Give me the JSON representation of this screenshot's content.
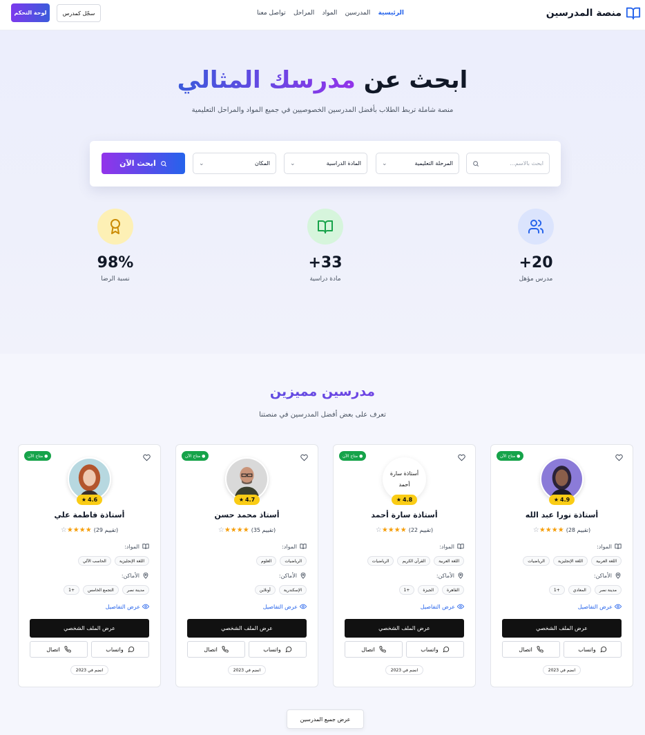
{
  "nav": {
    "brand": "منصة المدرسين",
    "links": [
      "الرئيسية",
      "المدرسين",
      "المواد",
      "المراحل",
      "تواصل معنا"
    ],
    "register_label": "سجّل كمدرس",
    "dashboard_label": "لوحة التحكم"
  },
  "hero": {
    "title_part1": "ابحث عن",
    "title_part2": "مدرسك المثالي",
    "subtitle": "منصة شاملة تربط الطلاب بأفضل المدرسين الخصوصيين في جميع المواد والمراحل التعليمية"
  },
  "search": {
    "placeholder": "ابحث بالاسم...",
    "stage": "المرحلة التعليمية",
    "subject": "المادة الدراسية",
    "location": "المكان",
    "button": "ابحث الآن"
  },
  "stats": [
    {
      "value": "+20",
      "label": "مدرس مؤهل",
      "icon": "users-icon",
      "color": "#dbe4fd"
    },
    {
      "value": "+33",
      "label": "مادة دراسية",
      "icon": "book-icon",
      "color": "#d6f5dc"
    },
    {
      "value": "98%",
      "label": "نسبة الرضا",
      "icon": "award-icon",
      "color": "#fdf0b5"
    }
  ],
  "featured": {
    "title": "مدرسين مميزين",
    "subtitle": "تعرف على بعض أفضل المدرسين في منصتنا",
    "available_label": "متاح الآن",
    "subjects_label": "المواد:",
    "locations_label": "الأماكن:",
    "details_label": "عرض التفاصيل",
    "profile_label": "عرض الملف الشخصي",
    "whatsapp_label": "واتساب",
    "call_label": "اتصال",
    "all_button": "عرض جميع المدرسين"
  },
  "teachers": [
    {
      "name": "أستاذة نورا عبد الله",
      "rating": "4.9",
      "reviews": "(28 تقييم)",
      "stars": 4,
      "subjects": [
        "اللغة العربية",
        "اللغة الإنجليزية",
        "الرياضيات"
      ],
      "locations": [
        "مدينة نصر",
        "المعادي",
        "+1"
      ],
      "joined": "انضم في 2023",
      "avatar": "photo"
    },
    {
      "name": "أستاذة سارة أحمد",
      "rating": "4.8",
      "reviews": "(22 تقييم)",
      "stars": 4,
      "subjects": [
        "اللغة العربية",
        "القرآن الكريم",
        "الرياضيات"
      ],
      "locations": [
        "القاهرة",
        "الجيزة",
        "+1"
      ],
      "joined": "انضم في 2023",
      "avatar": "text",
      "avatar_alt": "أستاذة سارة أحمد"
    },
    {
      "name": "أستاذ محمد حسن",
      "rating": "4.7",
      "reviews": "(35 تقييم)",
      "stars": 4,
      "subjects": [
        "الرياضيات",
        "العلوم"
      ],
      "locations": [
        "الإسكندرية",
        "أونلاين"
      ],
      "joined": "انضم في 2023",
      "avatar": "photo"
    },
    {
      "name": "أستاذة فاطمة علي",
      "rating": "4.6",
      "reviews": "(29 تقييم)",
      "stars": 4,
      "subjects": [
        "اللغة الإنجليزية",
        "الحاسب الآلي"
      ],
      "locations": [
        "مدينة نصر",
        "التجمع الخامس",
        "+1"
      ],
      "joined": "انضم في 2023",
      "avatar": "photo"
    }
  ]
}
